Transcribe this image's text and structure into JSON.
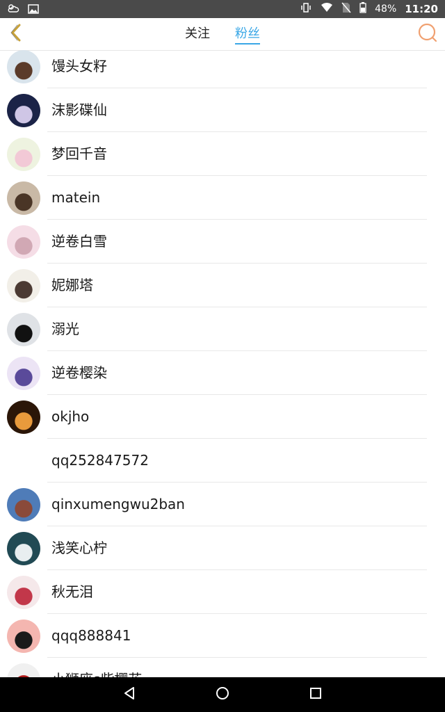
{
  "status_bar": {
    "battery": "48%",
    "time": "11:20",
    "icons": [
      "weather-icon",
      "gallery-icon",
      "vibrate-icon",
      "wifi-icon",
      "no-sim-icon",
      "battery-icon"
    ]
  },
  "header": {
    "tabs": [
      {
        "label": "关注",
        "active": false
      },
      {
        "label": "粉丝",
        "active": true
      }
    ],
    "accent_color": "#3aa7e6",
    "back_icon_color": "#c8a23a",
    "search_icon_color": "#f0a070"
  },
  "fans": [
    {
      "name": "馒头女籽",
      "avatar_colors": [
        "#d9e4ec",
        "#5b3b2a"
      ]
    },
    {
      "name": "沫影碟仙",
      "avatar_colors": [
        "#1b2347",
        "#cfc6e6"
      ]
    },
    {
      "name": "梦回千音",
      "avatar_colors": [
        "#eef3e0",
        "#f2c9d6"
      ]
    },
    {
      "name": "matein",
      "avatar_colors": [
        "#c9b9a6",
        "#4a3526"
      ]
    },
    {
      "name": "逆卷白雪",
      "avatar_colors": [
        "#f5dde6",
        "#d1a8b4"
      ]
    },
    {
      "name": "妮娜塔",
      "avatar_colors": [
        "#f2efe8",
        "#4b3a33"
      ]
    },
    {
      "name": "溺光",
      "avatar_colors": [
        "#dfe2e6",
        "#111111"
      ]
    },
    {
      "name": "逆卷樱染",
      "avatar_colors": [
        "#ece4f5",
        "#5a4a9a"
      ]
    },
    {
      "name": "okjho",
      "avatar_colors": [
        "#2b1608",
        "#e89a3c"
      ]
    },
    {
      "name": "qq252847572",
      "avatar_colors": [
        "#ffffff",
        "#ffffff"
      ]
    },
    {
      "name": "qinxumengwu2ban",
      "avatar_colors": [
        "#4f7cb8",
        "#8a4a3a"
      ]
    },
    {
      "name": "浅笑心柠",
      "avatar_colors": [
        "#214a54",
        "#e8eef0"
      ]
    },
    {
      "name": "秋无泪",
      "avatar_colors": [
        "#f5e8ea",
        "#c2374a"
      ]
    },
    {
      "name": "qqq888841",
      "avatar_colors": [
        "#f4b6b0",
        "#1a1a1a"
      ]
    },
    {
      "name": "小狮座s柴樱花",
      "avatar_colors": [
        "#f0f0f0",
        "#b01818"
      ]
    }
  ]
}
